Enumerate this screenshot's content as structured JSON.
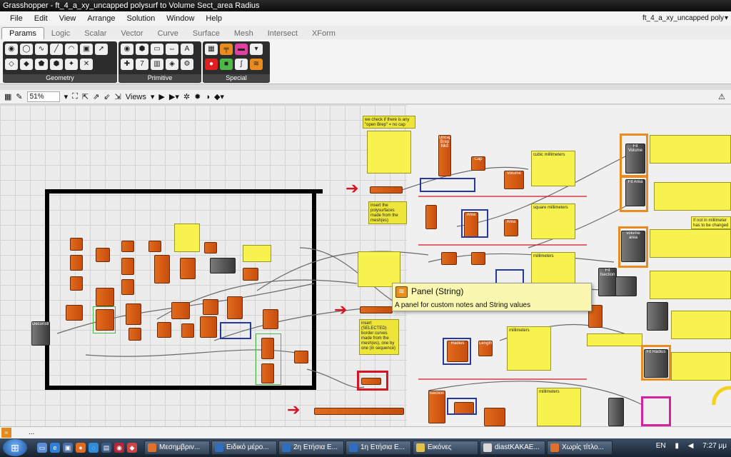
{
  "window": {
    "title": "Grasshopper - ft_4_a_xy_uncapped polysurf to Volume Sect_area Radius"
  },
  "menu": [
    "File",
    "Edit",
    "View",
    "Arrange",
    "Solution",
    "Window",
    "Help"
  ],
  "document_selector": {
    "value": "ft_4_a_xy_uncapped poly"
  },
  "tabs": [
    {
      "label": "Params",
      "active": true
    },
    {
      "label": "Logic"
    },
    {
      "label": "Scalar"
    },
    {
      "label": "Vector"
    },
    {
      "label": "Curve"
    },
    {
      "label": "Surface"
    },
    {
      "label": "Mesh"
    },
    {
      "label": "Intersect"
    },
    {
      "label": "XForm"
    }
  ],
  "ribbon_groups": [
    {
      "label": "Geometry"
    },
    {
      "label": "Primitive"
    },
    {
      "label": "Special"
    }
  ],
  "canvas_toolbar": {
    "zoom": "51%",
    "views_label": "Views"
  },
  "canvas": {
    "notes": [
      {
        "text": "we check if there is any \"open Brep\" = no cap"
      },
      {
        "text": "insert the polysurfaces made from the mesh(es)"
      },
      {
        "text": "insert (SELECTED) border curves made from the mesh(es), one by one (in sequence)"
      },
      {
        "text": "cubic millimeters"
      },
      {
        "text": "square millimeters"
      },
      {
        "text": "millimeters"
      },
      {
        "text": "millimeters"
      },
      {
        "text": "millimeters"
      },
      {
        "text": "If not in millimeter has to be changed"
      }
    ],
    "components": [
      {
        "label": "Uncapped Brep Nkd"
      },
      {
        "label": "Cap"
      },
      {
        "label": "Volume"
      },
      {
        "label": "Area"
      },
      {
        "label": "Fit Volume"
      },
      {
        "label": "Fit Area"
      },
      {
        "label": "volume area"
      },
      {
        "label": "Fit Isection"
      },
      {
        "label": "Fit Radius"
      },
      {
        "label": "Deconstruct"
      },
      {
        "label": "Area"
      },
      {
        "label": "Length"
      },
      {
        "label": "Radius"
      },
      {
        "label": "Isection"
      }
    ]
  },
  "tooltip": {
    "title": "Panel (String)",
    "description": "A panel for custom notes and String values"
  },
  "status_bar": {
    "text": "..."
  },
  "taskbar": {
    "buttons": [
      {
        "label": "Μεσημβριν...",
        "color": "#e0702a"
      },
      {
        "label": "Ειδικό μέρο...",
        "color": "#2d6fbe"
      },
      {
        "label": "2η Ετήσια Ε...",
        "color": "#2d6fbe"
      },
      {
        "label": "1η Ετήσια Ε...",
        "color": "#2d6fbe"
      },
      {
        "label": "Εικόνες",
        "color": "#e2c24a"
      },
      {
        "label": "diastKAKAE...",
        "color": "#d9d9d9"
      },
      {
        "label": "Χωρίς τίτλο...",
        "color": "#e0702a"
      }
    ],
    "lang": "EN",
    "time": "7:27 μμ"
  },
  "colors": {
    "accent_orange": "#e98b1f",
    "panel_yellow": "#f7f24d",
    "highlight_red": "#d41324",
    "highlight_blue": "#2438a0"
  }
}
